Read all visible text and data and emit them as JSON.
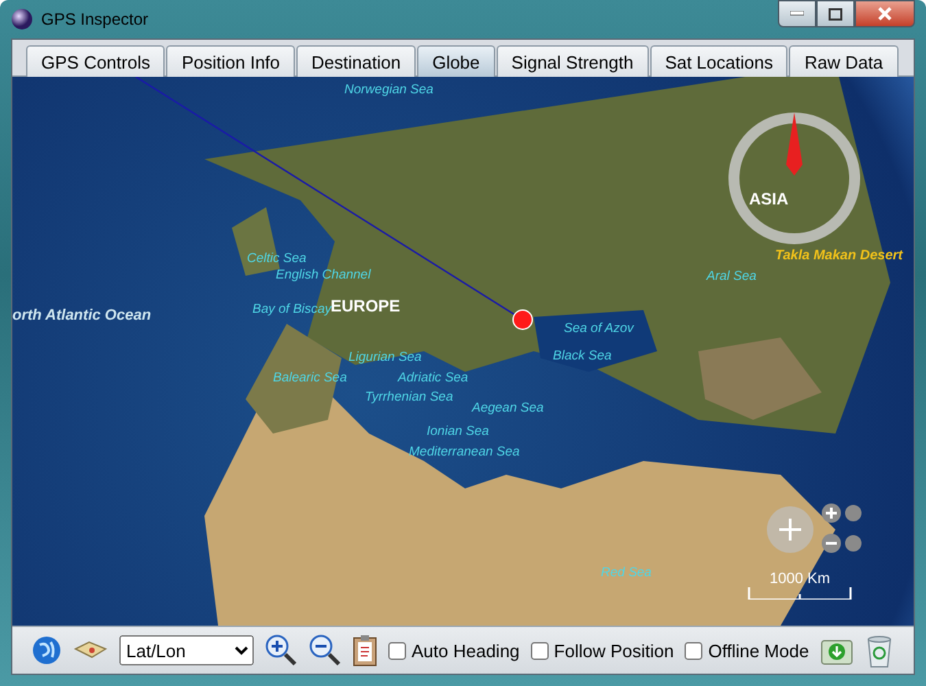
{
  "window": {
    "title": "GPS Inspector"
  },
  "tabs": [
    {
      "label": "GPS Controls",
      "selected": false
    },
    {
      "label": "Position Info",
      "selected": false
    },
    {
      "label": "Destination",
      "selected": false
    },
    {
      "label": "Globe",
      "selected": true
    },
    {
      "label": "Signal Strength",
      "selected": false
    },
    {
      "label": "Sat Locations",
      "selected": false
    },
    {
      "label": "Raw Data",
      "selected": false
    }
  ],
  "globe": {
    "labels": [
      {
        "text": "Norwegian Sea",
        "kind": "water"
      },
      {
        "text": "Celtic Sea",
        "kind": "water"
      },
      {
        "text": "English Channel",
        "kind": "water"
      },
      {
        "text": "EUROPE",
        "kind": "continent"
      },
      {
        "text": "Bay of Biscay",
        "kind": "water"
      },
      {
        "text": "orth Atlantic Ocean",
        "kind": "ocean"
      },
      {
        "text": "Sea of Azov",
        "kind": "water"
      },
      {
        "text": "Black Sea",
        "kind": "water"
      },
      {
        "text": "Ligurian Sea",
        "kind": "water"
      },
      {
        "text": "Balearic Sea",
        "kind": "water"
      },
      {
        "text": "Adriatic Sea",
        "kind": "water"
      },
      {
        "text": "Tyrrhenian Sea",
        "kind": "water"
      },
      {
        "text": "Aegean Sea",
        "kind": "water"
      },
      {
        "text": "Ionian Sea",
        "kind": "water"
      },
      {
        "text": "Mediterranean Sea",
        "kind": "water"
      },
      {
        "text": "Aral Sea",
        "kind": "water"
      },
      {
        "text": "ASIA",
        "kind": "continent"
      },
      {
        "text": "Takla Makan Desert",
        "kind": "desert"
      },
      {
        "text": "Red Sea",
        "kind": "water"
      }
    ],
    "scale": "1000 Km"
  },
  "toolbar": {
    "coordinate_format": "Lat/Lon",
    "checkboxes": [
      {
        "label": "Auto Heading",
        "checked": false
      },
      {
        "label": "Follow Position",
        "checked": false
      },
      {
        "label": "Offline Mode",
        "checked": false
      }
    ]
  }
}
